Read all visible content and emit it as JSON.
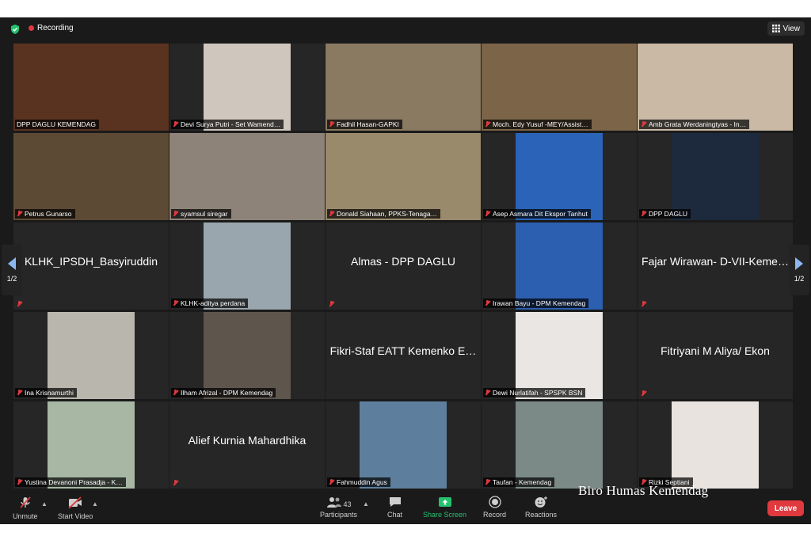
{
  "topbar": {
    "recording_label": "Recording",
    "view_label": "View"
  },
  "pager": {
    "left_label": "1/2",
    "right_label": "1/2"
  },
  "tiles": [
    {
      "name": "DPP DAGLU KEMENDAG",
      "big": "",
      "video": "full",
      "bg": "#5a3320",
      "active": true,
      "mic": false
    },
    {
      "name": "Devi Surya Putri - Set Wamend…",
      "big": "",
      "video": "center",
      "bg": "#cfc6bd",
      "active": false,
      "mic": true
    },
    {
      "name": "Fadhil Hasan-GAPKI",
      "big": "",
      "video": "full",
      "bg": "#8a7a62",
      "active": false,
      "mic": true
    },
    {
      "name": "Moch. Edy Yusuf -MEY/Assist…",
      "big": "",
      "video": "full",
      "bg": "#7c6448",
      "active": false,
      "mic": true
    },
    {
      "name": "Amb Grata Werdaningtyas - In…",
      "big": "",
      "video": "full",
      "bg": "#c9b9a5",
      "active": false,
      "mic": true
    },
    {
      "name": "Petrus Gunarso",
      "big": "",
      "video": "full",
      "bg": "#5d4a35",
      "active": false,
      "mic": true
    },
    {
      "name": "syamsul siregar",
      "big": "",
      "video": "full",
      "bg": "#8d8378",
      "active": false,
      "mic": true
    },
    {
      "name": "Donald Siahaan, PPKS-Tenaga…",
      "big": "",
      "video": "full",
      "bg": "#9a8a6c",
      "active": false,
      "mic": true
    },
    {
      "name": "Asep Asmara Dit Ekspor Tanhut",
      "big": "",
      "video": "center",
      "bg": "#2a63b8",
      "active": false,
      "mic": true
    },
    {
      "name": "DPP DAGLU",
      "big": "",
      "video": "center",
      "bg": "#1d2a3e",
      "active": false,
      "mic": true
    },
    {
      "name": "",
      "big": "KLHK_IPSDH_Basyiruddin",
      "video": "none",
      "bg": "",
      "active": false,
      "mic": true
    },
    {
      "name": "KLHK-aditya perdana",
      "big": "",
      "video": "center",
      "bg": "#9aa6ad",
      "active": false,
      "mic": true
    },
    {
      "name": "",
      "big": "Almas - DPP DAGLU",
      "video": "none",
      "bg": "",
      "active": false,
      "mic": true
    },
    {
      "name": "Irawan Bayu - DPM Kemendag",
      "big": "",
      "video": "center",
      "bg": "#2c5fb0",
      "active": false,
      "mic": true
    },
    {
      "name": "",
      "big": "Fajar Wirawan- D-VII-Keme…",
      "video": "none",
      "bg": "",
      "active": false,
      "mic": true
    },
    {
      "name": "Ina Krisnamurthi",
      "big": "",
      "video": "center",
      "bg": "#b9b6ad",
      "active": false,
      "mic": true
    },
    {
      "name": "Ilham Afrizal - DPM Kemendag",
      "big": "",
      "video": "center",
      "bg": "#5e554c",
      "active": false,
      "mic": true
    },
    {
      "name": "",
      "big": "Fikri-Staf EATT Kemenko E…",
      "video": "none",
      "bg": "",
      "active": false,
      "mic": false
    },
    {
      "name": "Dewi Nurlatifah - SPSPK BSN",
      "big": "",
      "video": "center",
      "bg": "#e9e6e3",
      "active": false,
      "mic": true
    },
    {
      "name": "",
      "big": "Fitriyani M Aliya/ Ekon",
      "video": "none",
      "bg": "",
      "active": false,
      "mic": true
    },
    {
      "name": "Yustina Devanoni Prasadja - K…",
      "big": "",
      "video": "center",
      "bg": "#a7b7a4",
      "active": false,
      "mic": true
    },
    {
      "name": "",
      "big": "Alief Kurnia Mahardhika",
      "video": "none",
      "bg": "",
      "active": false,
      "mic": true
    },
    {
      "name": "Fahmuddin Agus",
      "big": "",
      "video": "center",
      "bg": "#5d7f9d",
      "active": false,
      "mic": true
    },
    {
      "name": "Taufan - Kemendag",
      "big": "",
      "video": "center",
      "bg": "#7b8a86",
      "active": false,
      "mic": true
    },
    {
      "name": "Rizki Septiani",
      "big": "",
      "video": "center",
      "bg": "#e8e3df",
      "active": false,
      "mic": true
    }
  ],
  "toolbar": {
    "unmute_label": "Unmute",
    "start_video_label": "Start Video",
    "participants_label": "Participants",
    "participants_count": "43",
    "chat_label": "Chat",
    "share_screen_label": "Share Screen",
    "record_label": "Record",
    "reactions_label": "Reactions",
    "leave_label": "Leave"
  },
  "watermark": "Biro Humas Kemendag",
  "colors": {
    "window_bg": "#1a1a1a",
    "tile_bg": "#262626",
    "active_outline": "#e5e24f",
    "leave": "#e0393e",
    "share_green": "#25c16f",
    "recording_red": "#e0393e"
  }
}
